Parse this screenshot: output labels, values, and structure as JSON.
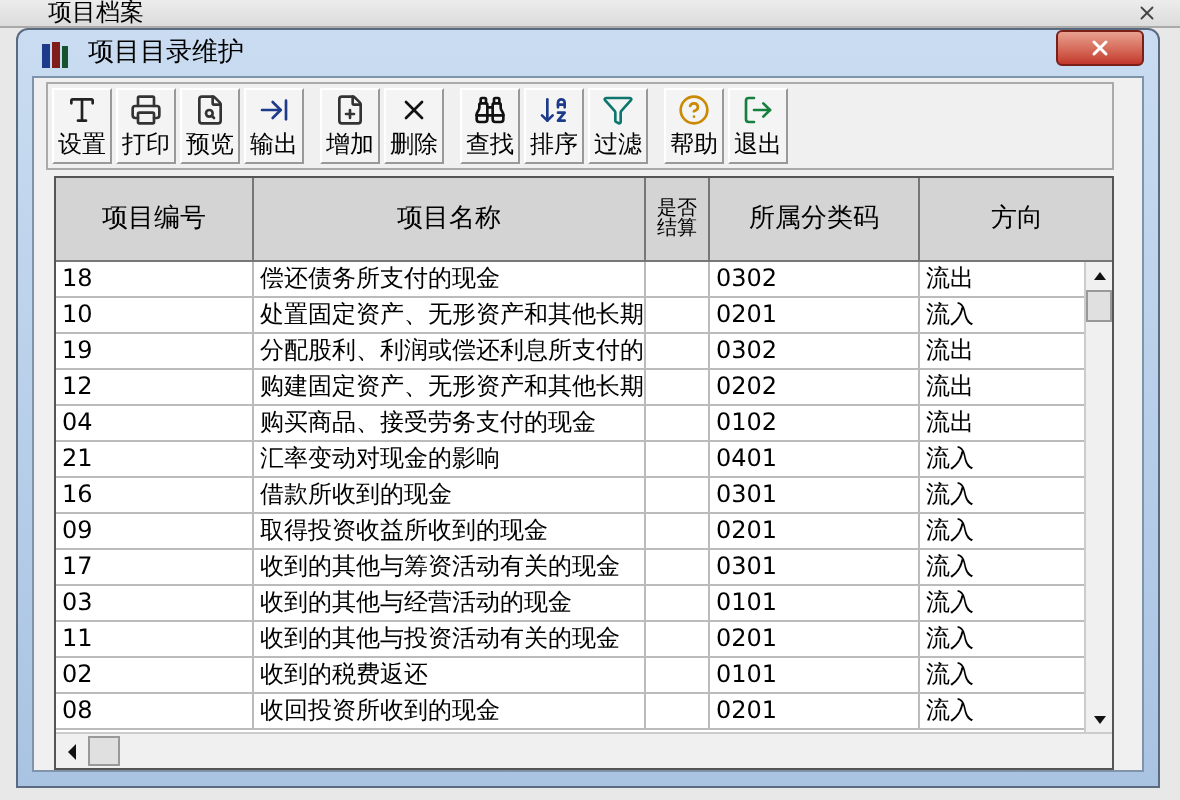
{
  "back_window": {
    "title": "项目档案"
  },
  "window": {
    "title": "项目目录维护"
  },
  "toolbar": [
    [
      "设置",
      "打印",
      "预览",
      "输出"
    ],
    [
      "增加",
      "删除"
    ],
    [
      "查找",
      "排序",
      "过滤"
    ],
    [
      "帮助",
      "退出"
    ]
  ],
  "table": {
    "columns": [
      "项目编号",
      "项目名称",
      "是否结算",
      "所属分类码",
      "方向"
    ],
    "rows": [
      [
        "18",
        "偿还债务所支付的现金",
        "",
        "0302",
        "流出"
      ],
      [
        "10",
        "处置固定资产、无形资产和其他长期",
        "",
        "0201",
        "流入"
      ],
      [
        "19",
        "分配股利、利润或偿还利息所支付的",
        "",
        "0302",
        "流出"
      ],
      [
        "12",
        "购建固定资产、无形资产和其他长期",
        "",
        "0202",
        "流出"
      ],
      [
        "04",
        "购买商品、接受劳务支付的现金",
        "",
        "0102",
        "流出"
      ],
      [
        "21",
        "汇率变动对现金的影响",
        "",
        "0401",
        "流入"
      ],
      [
        "16",
        "借款所收到的现金",
        "",
        "0301",
        "流入"
      ],
      [
        "09",
        "取得投资收益所收到的现金",
        "",
        "0201",
        "流入"
      ],
      [
        "17",
        "收到的其他与筹资活动有关的现金",
        "",
        "0301",
        "流入"
      ],
      [
        "03",
        "收到的其他与经营活动的现金",
        "",
        "0101",
        "流入"
      ],
      [
        "11",
        "收到的其他与投资活动有关的现金",
        "",
        "0201",
        "流入"
      ],
      [
        "02",
        "收到的税费返还",
        "",
        "0101",
        "流入"
      ],
      [
        "08",
        "收回投资所收到的现金",
        "",
        "0201",
        "流入"
      ]
    ]
  }
}
